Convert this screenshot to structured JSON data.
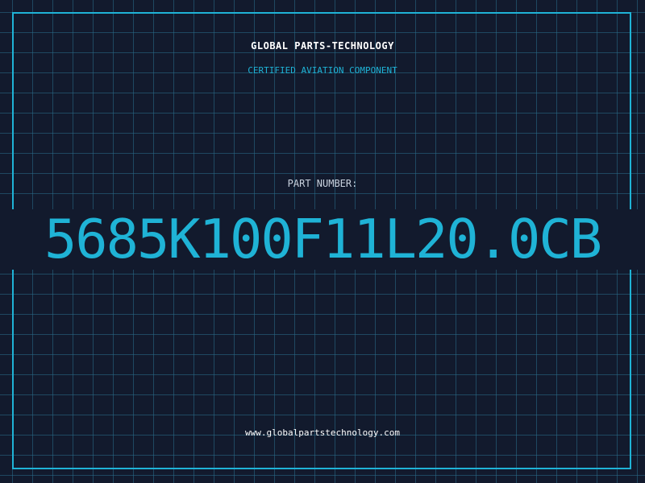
{
  "header": {
    "company": "GLOBAL PARTS-TECHNOLOGY",
    "subtitle": "CERTIFIED AVIATION COMPONENT"
  },
  "part": {
    "label": "PART NUMBER:",
    "number": "5685K100F11L20.0CB"
  },
  "footer": {
    "website": "www.globalpartstechnology.com"
  },
  "colors": {
    "background": "#121a2d",
    "accent": "#1fb3d6",
    "grid": "#2a6e8c",
    "label": "#c9d2de",
    "text": "#ffffff"
  }
}
